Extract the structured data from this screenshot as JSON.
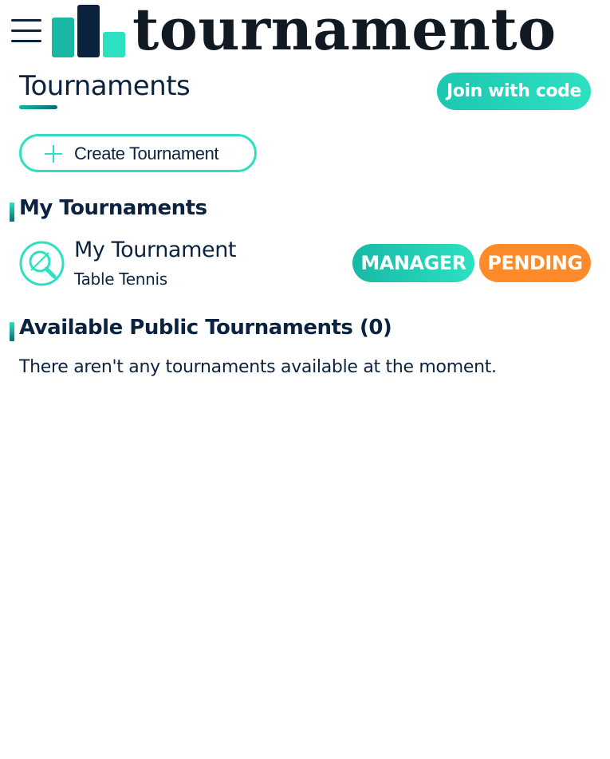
{
  "header": {
    "logo_text": "tournamento",
    "menu_icon": "hamburger-menu-icon"
  },
  "page": {
    "title": "Tournaments",
    "join_button_label": "Join with code",
    "create_button_label": "Create Tournament",
    "create_icon": "plus-icon"
  },
  "my_tournaments": {
    "heading": "My Tournaments",
    "items": [
      {
        "name": "My Tournament",
        "sport": "Table Tennis",
        "icon": "table-tennis-icon",
        "badges": [
          "MANAGER",
          "PENDING"
        ]
      }
    ]
  },
  "public_tournaments": {
    "heading": "Available Public Tournaments (0)",
    "empty_message": "There aren't any tournaments available at the moment."
  },
  "colors": {
    "navy": "#0c2340",
    "teal": "#1cc7b0",
    "mint": "#2ee0c2",
    "orange": "#ff8a2a"
  }
}
